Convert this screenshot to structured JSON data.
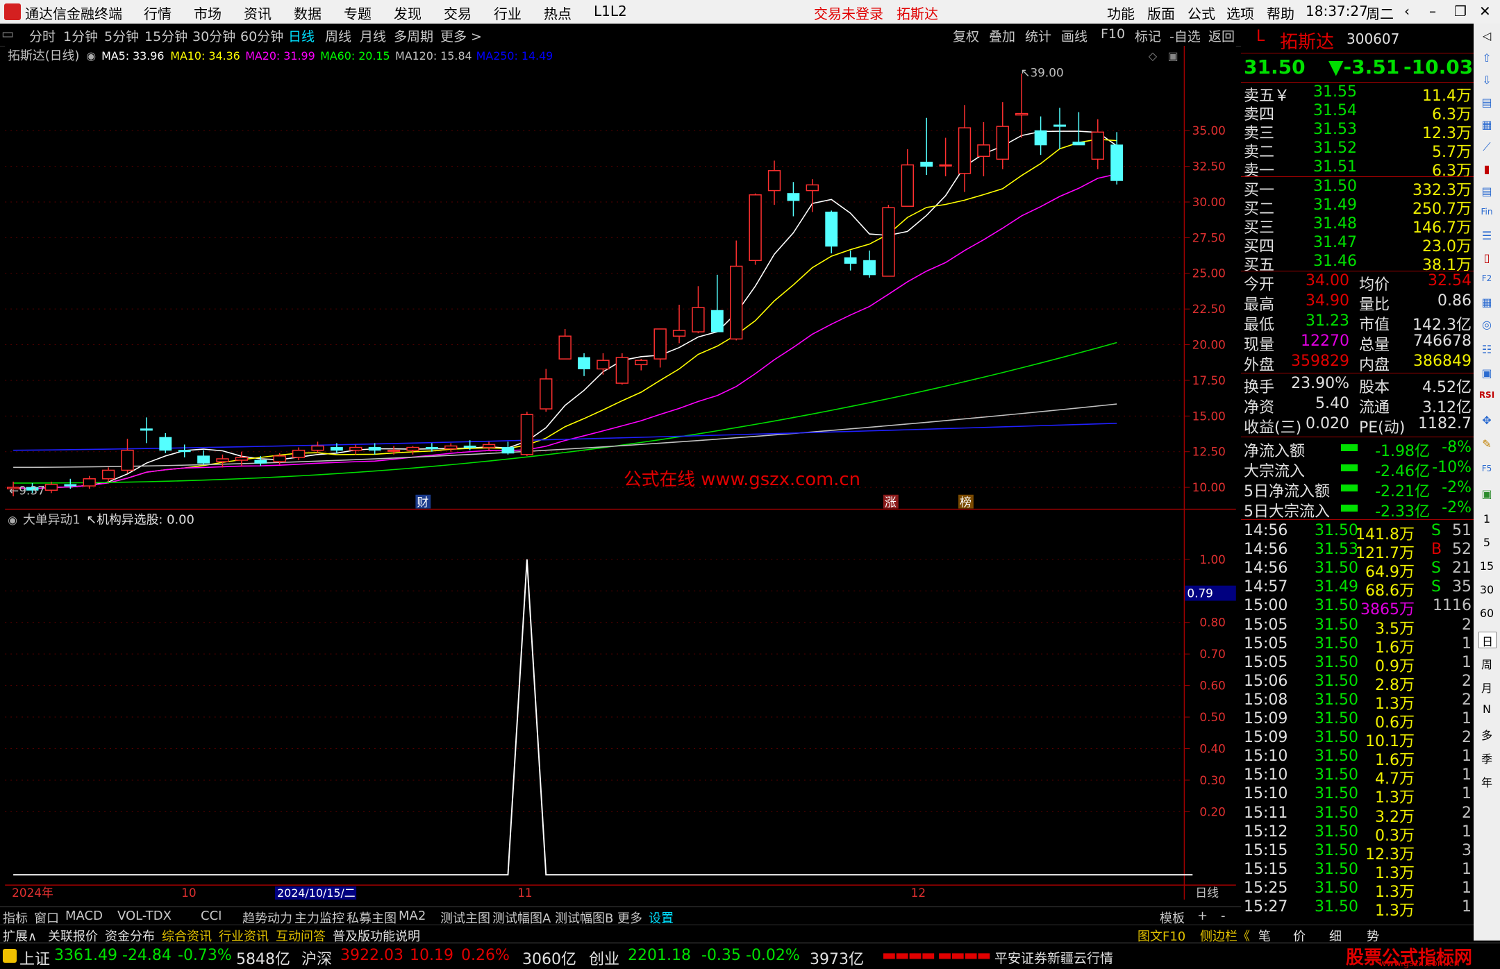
{
  "menubar": {
    "app_title": "通达信金融终端",
    "menus": [
      "行情",
      "市场",
      "资讯",
      "数据",
      "专题",
      "发现",
      "交易",
      "行业",
      "热点",
      "L1L2"
    ],
    "login_status": "交易未登录",
    "stock_name": "拓斯达",
    "right_menus": [
      "功能",
      "版面",
      "公式",
      "选项",
      "帮助"
    ],
    "time": "18:37:27",
    "weekday": "周二"
  },
  "periods": [
    "分时",
    "1分钟",
    "5分钟",
    "15分钟",
    "30分钟",
    "60分钟",
    "日线",
    "周线",
    "月线",
    "多周期",
    "更多 >"
  ],
  "active_period": "日线",
  "toolbar_right": [
    "复权",
    "叠加",
    "统计",
    "画线",
    "F10",
    "标记",
    "-自选",
    "返回"
  ],
  "chart_header": {
    "title": "拓斯达(日线)",
    "ma": [
      {
        "label": "MA5: 33.96",
        "color": "#ffffff"
      },
      {
        "label": "MA10: 34.36",
        "color": "#ffff00"
      },
      {
        "label": "MA20: 31.99",
        "color": "#ff00ff"
      },
      {
        "label": "MA60: 20.15",
        "color": "#00ff00"
      },
      {
        "label": "MA120: 15.84",
        "color": "#c0c0c0"
      },
      {
        "label": "MA250: 14.49",
        "color": "#0000ff"
      }
    ]
  },
  "price_axis": [
    "35.00",
    "32.50",
    "30.00",
    "27.50",
    "25.00",
    "22.50",
    "20.00",
    "17.50",
    "15.00",
    "12.50",
    "10.00"
  ],
  "high_marker": "39.00",
  "low_marker": "9.37",
  "markers": [
    "财",
    "涨",
    "榜"
  ],
  "watermark": "公式在线  www.gszx.com.cn",
  "indicator": {
    "title": "大单异动1",
    "sub": "机构异选股: 0.00",
    "axis": [
      "1.00",
      "0.90",
      "0.80",
      "0.70",
      "0.60",
      "0.50",
      "0.40",
      "0.30",
      "0.20"
    ],
    "cursor_value": "0.79"
  },
  "date_axis": [
    "2024年",
    "10",
    "2024/10/15/二",
    "11",
    "12"
  ],
  "period_label": "日线",
  "chart_data": {
    "type": "candlestick",
    "title": "拓斯达(日线)",
    "y_range": [
      9.0,
      39.5
    ],
    "candles": [
      {
        "o": 9.9,
        "h": 10.4,
        "l": 9.37,
        "c": 10.0
      },
      {
        "o": 10.0,
        "h": 10.3,
        "l": 9.6,
        "c": 9.8
      },
      {
        "o": 9.8,
        "h": 10.4,
        "l": 9.6,
        "c": 10.2
      },
      {
        "o": 10.2,
        "h": 10.6,
        "l": 9.9,
        "c": 10.1
      },
      {
        "o": 10.1,
        "h": 10.8,
        "l": 9.9,
        "c": 10.6
      },
      {
        "o": 10.6,
        "h": 11.4,
        "l": 10.4,
        "c": 11.2
      },
      {
        "o": 11.2,
        "h": 13.4,
        "l": 11.0,
        "c": 12.6
      },
      {
        "o": 14.1,
        "h": 14.9,
        "l": 13.1,
        "c": 14.0
      },
      {
        "o": 13.5,
        "h": 13.8,
        "l": 12.4,
        "c": 12.6
      },
      {
        "o": 12.6,
        "h": 13.0,
        "l": 12.1,
        "c": 12.5
      },
      {
        "o": 12.2,
        "h": 12.6,
        "l": 11.6,
        "c": 11.7
      },
      {
        "o": 11.8,
        "h": 12.3,
        "l": 11.4,
        "c": 12.0
      },
      {
        "o": 11.9,
        "h": 12.5,
        "l": 11.5,
        "c": 12.1
      },
      {
        "o": 11.9,
        "h": 12.2,
        "l": 11.5,
        "c": 11.7
      },
      {
        "o": 11.8,
        "h": 12.4,
        "l": 11.6,
        "c": 12.2
      },
      {
        "o": 12.1,
        "h": 12.8,
        "l": 11.9,
        "c": 12.6
      },
      {
        "o": 12.6,
        "h": 13.2,
        "l": 12.4,
        "c": 12.9
      },
      {
        "o": 12.8,
        "h": 13.1,
        "l": 12.4,
        "c": 12.6
      },
      {
        "o": 12.6,
        "h": 13.0,
        "l": 12.3,
        "c": 12.8
      },
      {
        "o": 12.8,
        "h": 13.1,
        "l": 12.3,
        "c": 12.6
      },
      {
        "o": 12.6,
        "h": 12.9,
        "l": 12.3,
        "c": 12.6
      },
      {
        "o": 12.6,
        "h": 12.9,
        "l": 12.3,
        "c": 12.8
      },
      {
        "o": 12.8,
        "h": 13.1,
        "l": 12.5,
        "c": 12.7
      },
      {
        "o": 12.7,
        "h": 13.1,
        "l": 12.5,
        "c": 12.9
      },
      {
        "o": 12.9,
        "h": 13.3,
        "l": 12.6,
        "c": 12.8
      },
      {
        "o": 12.8,
        "h": 13.2,
        "l": 12.6,
        "c": 13.0
      },
      {
        "o": 12.8,
        "h": 13.2,
        "l": 12.3,
        "c": 12.4
      },
      {
        "o": 12.3,
        "h": 15.3,
        "l": 12.2,
        "c": 15.1
      },
      {
        "o": 15.5,
        "h": 18.3,
        "l": 15.3,
        "c": 17.6
      },
      {
        "o": 19.0,
        "h": 21.1,
        "l": 19.0,
        "c": 20.6
      },
      {
        "o": 19.1,
        "h": 19.4,
        "l": 17.8,
        "c": 18.3
      },
      {
        "o": 18.3,
        "h": 19.4,
        "l": 17.9,
        "c": 18.9
      },
      {
        "o": 17.3,
        "h": 19.4,
        "l": 17.2,
        "c": 19.1
      },
      {
        "o": 18.6,
        "h": 19.0,
        "l": 18.2,
        "c": 18.9
      },
      {
        "o": 19.0,
        "h": 21.1,
        "l": 18.4,
        "c": 21.1
      },
      {
        "o": 20.6,
        "h": 22.8,
        "l": 20.1,
        "c": 21.0
      },
      {
        "o": 20.9,
        "h": 24.1,
        "l": 20.8,
        "c": 22.6
      },
      {
        "o": 22.4,
        "h": 24.9,
        "l": 20.9,
        "c": 20.9
      },
      {
        "o": 20.4,
        "h": 27.3,
        "l": 20.3,
        "c": 25.5
      },
      {
        "o": 25.9,
        "h": 30.6,
        "l": 25.6,
        "c": 30.5
      },
      {
        "o": 30.8,
        "h": 32.9,
        "l": 29.8,
        "c": 32.2
      },
      {
        "o": 30.6,
        "h": 31.4,
        "l": 29.0,
        "c": 30.1
      },
      {
        "o": 30.8,
        "h": 31.6,
        "l": 29.3,
        "c": 31.2
      },
      {
        "o": 29.3,
        "h": 29.4,
        "l": 26.4,
        "c": 26.9
      },
      {
        "o": 26.1,
        "h": 26.6,
        "l": 25.2,
        "c": 25.7
      },
      {
        "o": 25.9,
        "h": 26.6,
        "l": 24.7,
        "c": 24.9
      },
      {
        "o": 24.8,
        "h": 29.8,
        "l": 24.8,
        "c": 29.6
      },
      {
        "o": 29.7,
        "h": 33.7,
        "l": 29.7,
        "c": 32.6
      },
      {
        "o": 32.8,
        "h": 35.9,
        "l": 31.9,
        "c": 32.5
      },
      {
        "o": 32.6,
        "h": 34.5,
        "l": 31.8,
        "c": 32.6
      },
      {
        "o": 32.0,
        "h": 36.8,
        "l": 30.7,
        "c": 35.2
      },
      {
        "o": 33.2,
        "h": 35.6,
        "l": 31.8,
        "c": 34.0
      },
      {
        "o": 33.0,
        "h": 37.0,
        "l": 32.3,
        "c": 35.3
      },
      {
        "o": 36.1,
        "h": 39.0,
        "l": 34.5,
        "c": 36.2
      },
      {
        "o": 35.0,
        "h": 36.0,
        "l": 33.3,
        "c": 34.0
      },
      {
        "o": 35.4,
        "h": 36.6,
        "l": 33.7,
        "c": 35.3
      },
      {
        "o": 34.2,
        "h": 36.3,
        "l": 34.2,
        "c": 34.0
      },
      {
        "o": 33.0,
        "h": 35.8,
        "l": 32.3,
        "c": 34.9
      },
      {
        "o": 34.0,
        "h": 34.9,
        "l": 31.23,
        "c": 31.5
      }
    ],
    "indicator_series": {
      "name": "机构异选股",
      "spike_index": 27,
      "spike_value": 1.0
    }
  },
  "quote": {
    "name": "拓斯达",
    "code": "300607",
    "price": "31.50",
    "change": "▼-3.51",
    "pct": "-10.03%",
    "asks": [
      {
        "label": "卖五￥",
        "price": "31.55",
        "vol": "11.4万"
      },
      {
        "label": "卖四",
        "price": "31.54",
        "vol": "6.3万"
      },
      {
        "label": "卖三",
        "price": "31.53",
        "vol": "12.3万"
      },
      {
        "label": "卖二",
        "price": "31.52",
        "vol": "5.7万"
      },
      {
        "label": "卖一",
        "price": "31.51",
        "vol": "6.3万"
      }
    ],
    "bids": [
      {
        "label": "买一",
        "price": "31.50",
        "vol": "332.3万"
      },
      {
        "label": "买二",
        "price": "31.49",
        "vol": "250.7万"
      },
      {
        "label": "买三",
        "price": "31.48",
        "vol": "146.7万"
      },
      {
        "label": "买四",
        "price": "31.47",
        "vol": "23.0万"
      },
      {
        "label": "买五",
        "price": "31.46",
        "vol": "38.1万"
      }
    ],
    "stats": [
      {
        "l1": "今开",
        "v1": "34.00",
        "l2": "均价",
        "v2": "32.54"
      },
      {
        "l1": "最高",
        "v1": "34.90",
        "l2": "量比",
        "v2": "0.86"
      },
      {
        "l1": "最低",
        "v1": "31.23",
        "l2": "市值",
        "v2": "142.3亿"
      },
      {
        "l1": "现量",
        "v1": "12270",
        "l2": "总量",
        "v2": "746678"
      },
      {
        "l1": "外盘",
        "v1": "359829",
        "l2": "内盘",
        "v2": "386849"
      }
    ],
    "stats2": [
      {
        "l1": "换手",
        "v1": "23.90%",
        "l2": "股本",
        "v2": "4.52亿"
      },
      {
        "l1": "净资",
        "v1": "5.40",
        "l2": "流通",
        "v2": "3.12亿"
      },
      {
        "l1": "收益(三)",
        "v1": "0.020",
        "l2": "PE(动)",
        "v2": "1182.7"
      }
    ],
    "flows": [
      {
        "label": "净流入额",
        "val": "-1.98亿",
        "pct": "-8%"
      },
      {
        "label": "大宗流入",
        "val": "-2.46亿",
        "pct": "-10%"
      },
      {
        "label": "5日净流入额",
        "val": "-2.21亿",
        "pct": "-2%"
      },
      {
        "label": "5日大宗流入",
        "val": "-2.33亿",
        "pct": "-2%"
      }
    ],
    "ticks": [
      {
        "t": "14:56",
        "p": "31.50",
        "v": "141.8万",
        "s": "S",
        "n": "51"
      },
      {
        "t": "14:56",
        "p": "31.53",
        "v": "121.7万",
        "s": "B",
        "n": "52"
      },
      {
        "t": "14:56",
        "p": "31.50",
        "v": "64.9万",
        "s": "S",
        "n": "21"
      },
      {
        "t": "14:57",
        "p": "31.49",
        "v": "68.6万",
        "s": "S",
        "n": "35"
      },
      {
        "t": "15:00",
        "p": "31.50",
        "v": "3865万",
        "s": "",
        "n": "1116"
      },
      {
        "t": "15:05",
        "p": "31.50",
        "v": "3.5万",
        "s": "",
        "n": "2"
      },
      {
        "t": "15:05",
        "p": "31.50",
        "v": "1.6万",
        "s": "",
        "n": "1"
      },
      {
        "t": "15:05",
        "p": "31.50",
        "v": "0.9万",
        "s": "",
        "n": "1"
      },
      {
        "t": "15:06",
        "p": "31.50",
        "v": "2.8万",
        "s": "",
        "n": "2"
      },
      {
        "t": "15:08",
        "p": "31.50",
        "v": "1.3万",
        "s": "",
        "n": "2"
      },
      {
        "t": "15:09",
        "p": "31.50",
        "v": "0.6万",
        "s": "",
        "n": "1"
      },
      {
        "t": "15:09",
        "p": "31.50",
        "v": "10.1万",
        "s": "",
        "n": "2"
      },
      {
        "t": "15:10",
        "p": "31.50",
        "v": "1.6万",
        "s": "",
        "n": "1"
      },
      {
        "t": "15:10",
        "p": "31.50",
        "v": "4.7万",
        "s": "",
        "n": "1"
      },
      {
        "t": "15:10",
        "p": "31.50",
        "v": "1.3万",
        "s": "",
        "n": "1"
      },
      {
        "t": "15:11",
        "p": "31.50",
        "v": "3.2万",
        "s": "",
        "n": "2"
      },
      {
        "t": "15:12",
        "p": "31.50",
        "v": "0.3万",
        "s": "",
        "n": "1"
      },
      {
        "t": "15:15",
        "p": "31.50",
        "v": "12.3万",
        "s": "",
        "n": "3"
      },
      {
        "t": "15:15",
        "p": "31.50",
        "v": "1.3万",
        "s": "",
        "n": "1"
      },
      {
        "t": "15:25",
        "p": "31.50",
        "v": "1.3万",
        "s": "",
        "n": "1"
      },
      {
        "t": "15:27",
        "p": "31.50",
        "v": "1.3万",
        "s": "",
        "n": "1"
      }
    ]
  },
  "sidebar_labels": [
    "RSI",
    "1",
    "5",
    "15",
    "30",
    "60",
    "日",
    "周",
    "月",
    "N",
    "多",
    "季",
    "年"
  ],
  "bottom_tabs1": [
    "指标",
    "窗口",
    "MACD",
    "VOL-TDX",
    "CCI",
    "趋势动力",
    "主力监控",
    "私募主图",
    "MA2",
    "测试主图",
    "测试幅图A",
    "测试幅图B",
    "更多",
    "设置"
  ],
  "bottom_tabs1_right": [
    "模板",
    "+",
    "-"
  ],
  "bottom_tabs2": [
    "扩展∧",
    "关联报价",
    "资金分布",
    "综合资讯",
    "行业资讯",
    "互动问答",
    "普及版功能说明"
  ],
  "bottom_tabs2_right": [
    "图文F10",
    "侧边栏《",
    "笔",
    "价",
    "细",
    "势"
  ],
  "status": {
    "sh_label": "上证",
    "sh_val": "3361.49",
    "sh_chg": "-24.84",
    "sh_pct": "-0.73%",
    "sh_amt": "5848亿",
    "hs_label": "沪深",
    "hs_val": "3922.03",
    "hs_chg": "10.19",
    "hs_pct": "0.26%",
    "hs_amt": "3060亿",
    "cy_label": "创业",
    "cy_val": "2201.18",
    "cy_chg": "-0.35",
    "cy_pct": "-0.02%",
    "cy_amt": "3973亿",
    "broker": "平安证券新疆云行情",
    "site_logo": "股票公式指标网",
    "site_url": "www.gszx.com.cn"
  }
}
